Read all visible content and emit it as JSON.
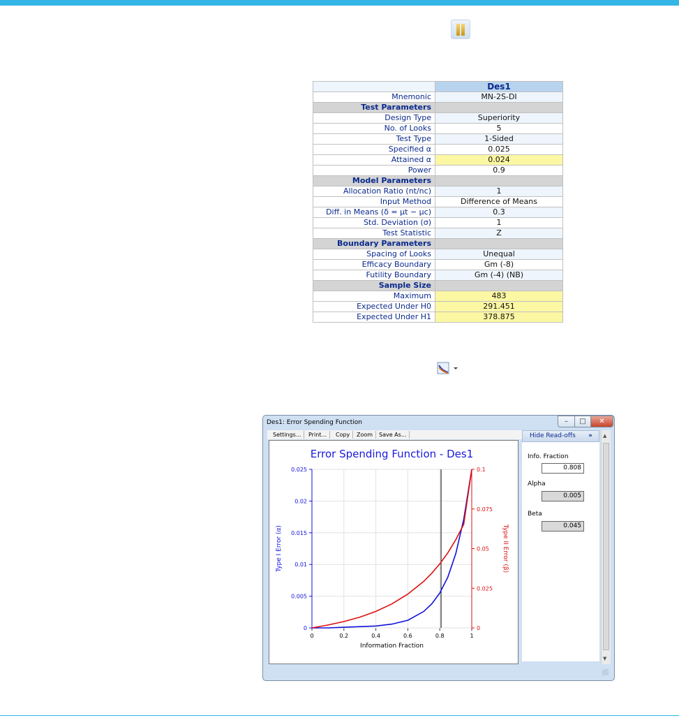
{
  "summary": {
    "column_header": "Des1",
    "rows": [
      {
        "label": "Mnemonic",
        "value": "MN-2S-DI"
      },
      {
        "section": "Test Parameters"
      },
      {
        "label": "Design Type",
        "value": "Superiority"
      },
      {
        "label": "No. of Looks",
        "value": "5"
      },
      {
        "label": "Test Type",
        "value": "1-Sided"
      },
      {
        "label": "Specified α",
        "value": "0.025"
      },
      {
        "label": "Attained α",
        "value": "0.024",
        "highlight": true
      },
      {
        "label": "Power",
        "value": "0.9"
      },
      {
        "section": "Model Parameters"
      },
      {
        "label": "Allocation Ratio (nt/nc)",
        "value": "1"
      },
      {
        "label": "Input Method",
        "value": "Difference of Means"
      },
      {
        "label": "Diff. in Means (δ = μt − μc)",
        "value": "0.3"
      },
      {
        "label": "Std. Deviation (σ)",
        "value": "1"
      },
      {
        "label": "Test Statistic",
        "value": "Z"
      },
      {
        "section": "Boundary Parameters"
      },
      {
        "label": "Spacing of Looks",
        "value": "Unequal"
      },
      {
        "label": "Efficacy Boundary",
        "value": "Gm (-8)"
      },
      {
        "label": "Futility Boundary",
        "value": "Gm (-4) (NB)"
      },
      {
        "section": "Sample Size"
      },
      {
        "label": "Maximum",
        "value": "483",
        "highlight": true
      },
      {
        "label": "Expected Under H0",
        "value": "291.451",
        "highlight": true
      },
      {
        "label": "Expected Under H1",
        "value": "378.875",
        "highlight": true
      }
    ]
  },
  "window": {
    "title": "Des1: Error Spending Function",
    "controls": {
      "minimize": "–",
      "maximize": "□",
      "close": "✕"
    },
    "toolbar": [
      "Settings...",
      "Print...",
      "Copy",
      "Zoom",
      "Save As..."
    ],
    "side": {
      "hide_label": "Hide Read-offs",
      "chevron": "»",
      "info_label": "Info. Fraction",
      "info_value": "0.808",
      "alpha_label": "Alpha",
      "alpha_value": "0.005",
      "beta_label": "Beta",
      "beta_value": "0.045"
    }
  },
  "colors": {
    "alpha_curve": "#1010dd",
    "beta_curve": "#dd1010",
    "title": "#1a1adb"
  },
  "chart_data": {
    "type": "line",
    "title": "Error Spending Function - Des1",
    "xlabel": "Information Fraction",
    "ylabel_left": "Type I Error (α)",
    "ylabel_right": "Type II Error (β)",
    "xlim": [
      0,
      1
    ],
    "ylim_left": [
      0,
      0.025
    ],
    "ylim_right": [
      0,
      0.1
    ],
    "x_ticks": [
      "0",
      "0.2",
      "0.4",
      "0.6",
      "0.8",
      "1"
    ],
    "y_left_ticks": [
      "0",
      "0.005",
      "0.01",
      "0.015",
      "0.02",
      "0.025"
    ],
    "y_right_ticks": [
      "0",
      "0.025",
      "0.05",
      "0.075",
      "0.1"
    ],
    "grid": true,
    "vertical_marker_x": 0.808,
    "x": [
      0,
      0.1,
      0.2,
      0.3,
      0.4,
      0.5,
      0.6,
      0.7,
      0.75,
      0.8,
      0.85,
      0.9,
      0.95,
      1.0
    ],
    "series": [
      {
        "axis": "left",
        "values": [
          0,
          0.0,
          0.0001,
          0.0002,
          0.0003,
          0.0006,
          0.0012,
          0.0026,
          0.0038,
          0.0055,
          0.008,
          0.0117,
          0.0171,
          0.025
        ]
      },
      {
        "axis": "right",
        "values": [
          0,
          0.0018,
          0.004,
          0.0068,
          0.0104,
          0.0151,
          0.0213,
          0.0294,
          0.0345,
          0.0404,
          0.0473,
          0.0556,
          0.0653,
          0.1
        ]
      }
    ]
  }
}
